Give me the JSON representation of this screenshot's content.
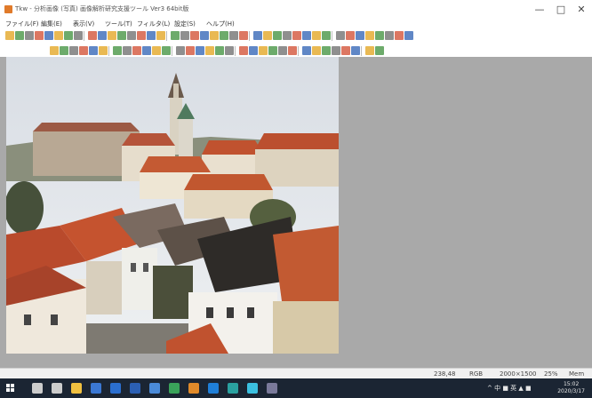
{
  "window": {
    "title": "Tkw - 分析画像 (写真) 画像解析研究支援ツール Ver3 64bit版",
    "controls": [
      "—",
      "□",
      "✕"
    ]
  },
  "menu": [
    "ファイル(F)",
    "編集(E)",
    "表示(V)",
    "ツール(T)",
    "フィルタ(L)",
    "設定(S)",
    "ヘルプ(H)"
  ],
  "toolbar": {
    "row1_count": 40,
    "row2_count": 32,
    "accent_colors": [
      "#2b5fb3",
      "#3c8f3a",
      "#d04a2e",
      "#e2a21a",
      "#6a6a6a"
    ]
  },
  "image": {
    "subject": "historic town rooftops with church tower",
    "colors": {
      "sky": "#e6e8ec",
      "roof": "#b94a2c",
      "wall": "#e9e3d6",
      "tower": "#d8d2c4",
      "tree": "#3f4a30"
    }
  },
  "status": {
    "coords": "238,48",
    "mode": "RGB",
    "size": "2000×1500",
    "zoom": "25%",
    "memory": "Mem"
  },
  "taskbar": {
    "icons": [
      "search",
      "task-view",
      "explorer",
      "store",
      "mail",
      "word",
      "photos",
      "app-green",
      "app-orange",
      "app-blue",
      "app-teal",
      "app-cyan",
      "app-settings"
    ],
    "tray": "^ 中 ■ 英 ▲ ■",
    "time": "15:02",
    "date": "2020/3/17"
  }
}
